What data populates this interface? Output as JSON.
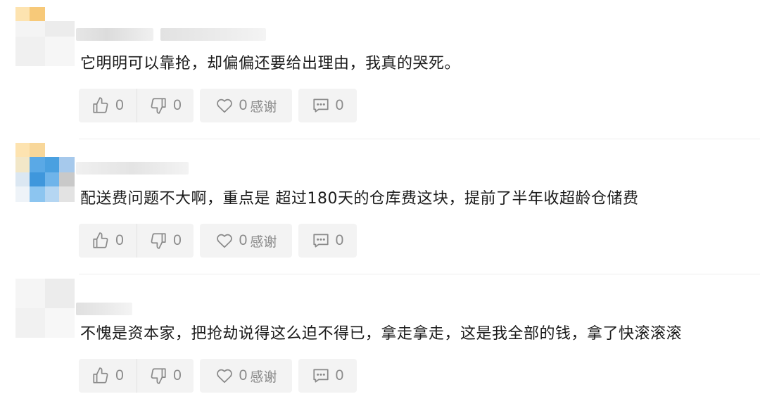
{
  "comments": [
    {
      "text": "它明明可以靠抢，却偏偏还要给出理由，我真的哭死。",
      "likes": "0",
      "dislikes": "0",
      "thanks_count": "0",
      "thanks_label": "感谢",
      "replies": "0"
    },
    {
      "text": "配送费问题不大啊，重点是 超过180天的仓库费这块，提前了半年收超龄仓储费",
      "likes": "0",
      "dislikes": "0",
      "thanks_count": "0",
      "thanks_label": "感谢",
      "replies": "0"
    },
    {
      "text": "不愧是资本家，把抢劫说得这么迫不得已，拿走拿走，这是我全部的钱，拿了快滚滚滚",
      "likes": "0",
      "dislikes": "0",
      "thanks_count": "0",
      "thanks_label": "感谢",
      "replies": "0"
    }
  ],
  "icons": {
    "like": "thumbs-up-icon",
    "dislike": "thumbs-down-icon",
    "thanks": "heart-icon",
    "reply": "comment-icon"
  },
  "colors": {
    "button_bg": "#f3f3f3",
    "icon_gray": "#8a8a8a",
    "text": "#1a1a1a"
  }
}
